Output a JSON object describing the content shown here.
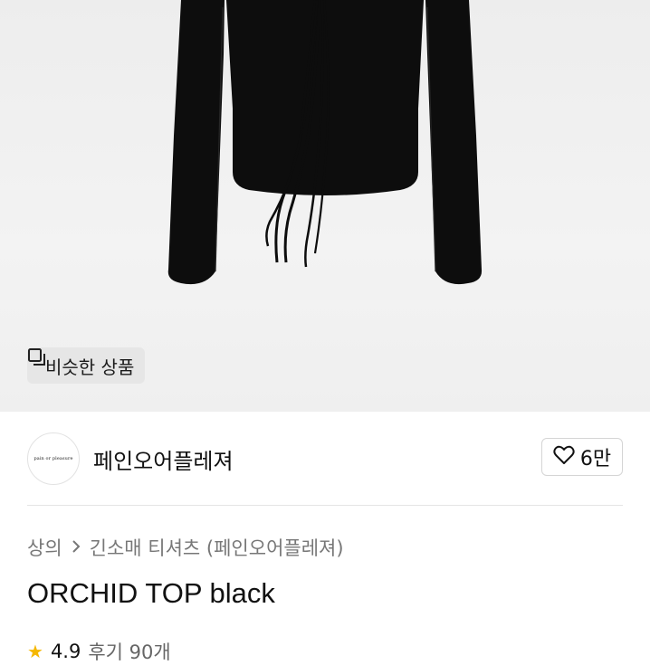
{
  "hero": {
    "image_name": "product-photo",
    "similar_button": {
      "icon": "copy-icon",
      "label": "비슷한 상품"
    }
  },
  "shop": {
    "avatar_text": "pain or pleasure",
    "name": "페인오어플레져",
    "like": {
      "icon": "heart-outline-icon",
      "count": "6만"
    }
  },
  "breadcrumb": {
    "items": [
      "상의",
      "긴소매 티셔츠 (페인오어플레져)"
    ],
    "separator_icon": "chevron-right-icon"
  },
  "product": {
    "title": "ORCHID TOP black",
    "rating": {
      "icon": "star-icon",
      "score": "4.9",
      "reviews": "후기 90개"
    }
  },
  "colors": {
    "hero_bg": "#efefef",
    "garment": "#0d0d0d",
    "star": "#f5b700"
  }
}
